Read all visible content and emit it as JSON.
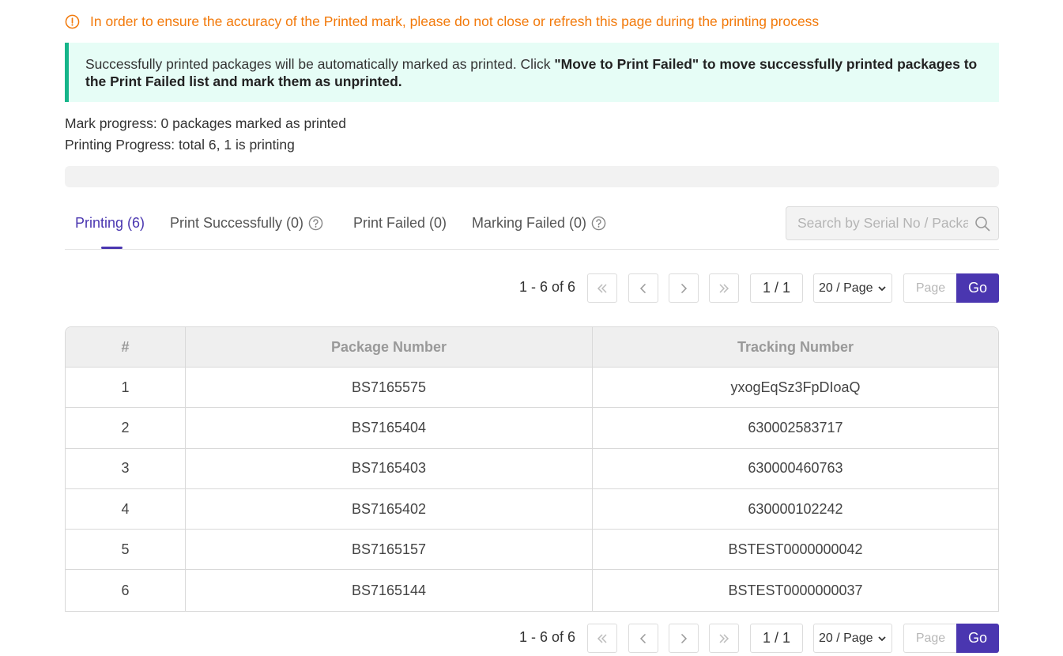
{
  "warning": {
    "text": "In order to ensure the accuracy of the Printed mark, please do not close or refresh this page during the printing process"
  },
  "info": {
    "text_plain": "Successfully printed packages will be automatically marked as printed. Click ",
    "text_bold": "\"Move to Print Failed\" to move successfully printed packages to the Print Failed list and mark them as unprinted."
  },
  "progress": {
    "mark_text": "Mark progress: 0 packages marked as printed",
    "print_text": "Printing Progress: total 6, 1 is printing",
    "bar_fraction": 0
  },
  "tabs": [
    {
      "label": "Printing (6)",
      "active": true
    },
    {
      "label": "Print Successfully (0)",
      "help": true
    },
    {
      "label": "Print Failed (0)"
    },
    {
      "label": "Marking Failed (0)",
      "help": true
    }
  ],
  "search": {
    "placeholder": "Search by Serial No / Package No"
  },
  "pager": {
    "range": "1 - 6 of 6",
    "pages": "1 / 1",
    "page_size": "20 / Page",
    "page_placeholder": "Page",
    "go_label": "Go"
  },
  "table": {
    "headers": [
      "#",
      "Package Number",
      "Tracking Number"
    ],
    "rows": [
      [
        "1",
        "BS7165575",
        "yxogEqSz3FpDIoaQ"
      ],
      [
        "2",
        "BS7165404",
        "630002583717"
      ],
      [
        "3",
        "BS7165403",
        "630000460763"
      ],
      [
        "4",
        "BS7165402",
        "630000102242"
      ],
      [
        "5",
        "BS7165157",
        "BSTEST0000000042"
      ],
      [
        "6",
        "BS7165144",
        "BSTEST0000000037"
      ]
    ]
  },
  "colors": {
    "accent": "#4a36b0",
    "warning": "#f2790a",
    "info_bg": "#e6fdf6",
    "info_border": "#16b58a"
  }
}
